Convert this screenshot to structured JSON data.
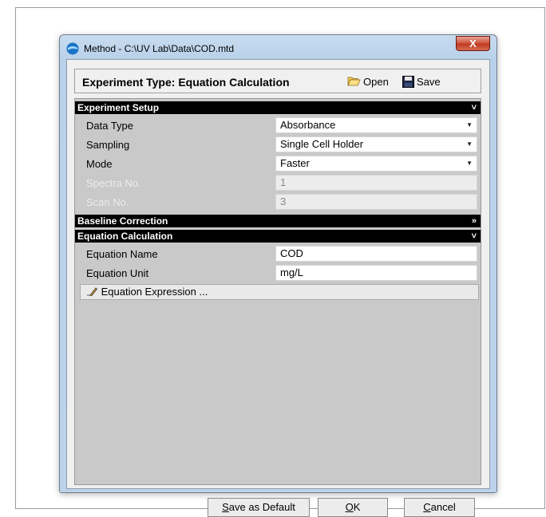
{
  "window": {
    "title": "Method - C:\\UV Lab\\Data\\COD.mtd",
    "close_label": "X"
  },
  "header": {
    "title": "Experiment Type:  Equation Calculation",
    "open_label": "Open",
    "save_label": "Save"
  },
  "sections": {
    "experiment_setup": {
      "title": "Experiment Setup",
      "chevron": "˅",
      "rows": [
        {
          "label": "Data Type",
          "value": "Absorbance"
        },
        {
          "label": "Sampling",
          "value": "Single Cell Holder"
        },
        {
          "label": "Mode",
          "value": "Faster"
        },
        {
          "label": "Spectra No.",
          "value": "1"
        },
        {
          "label": "Scan No.",
          "value": "3"
        }
      ]
    },
    "baseline_correction": {
      "title": "Baseline Correction",
      "chevron": "»"
    },
    "equation_calculation": {
      "title": "Equation Calculation",
      "chevron": "˅",
      "rows": [
        {
          "label": "Equation Name",
          "value": "COD"
        },
        {
          "label": "Equation Unit",
          "value": "mg/L"
        }
      ],
      "expression_button": "Equation Expression ..."
    }
  },
  "footer": {
    "save_default": {
      "prefix": "",
      "accel": "S",
      "rest": "ave as Default"
    },
    "ok": {
      "accel": "O",
      "rest": "K"
    },
    "cancel": {
      "accel": "C",
      "rest": "ancel"
    }
  },
  "colors": {
    "section_bg": "#000000",
    "panel_bg": "#c9c9c9",
    "close_button": "#c74a30"
  }
}
